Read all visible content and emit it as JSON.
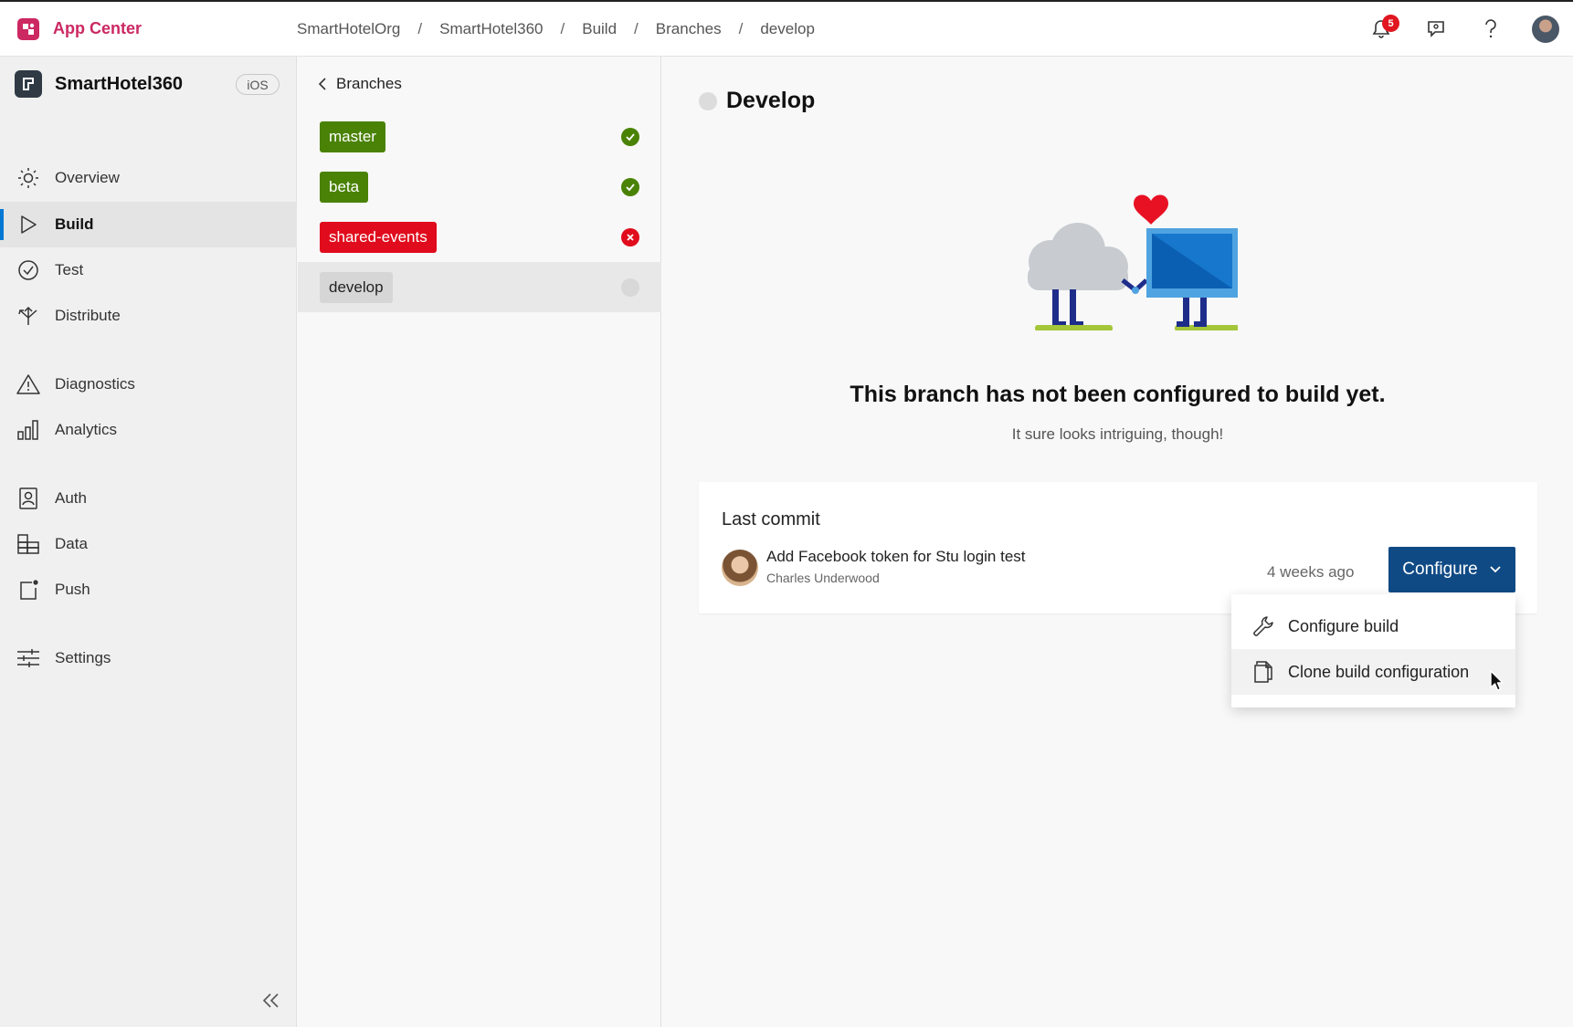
{
  "app": {
    "brand": "App Center"
  },
  "breadcrumb": [
    "SmartHotelOrg",
    "SmartHotel360",
    "Build",
    "Branches",
    "develop"
  ],
  "breadcrumb_sep": "/",
  "notifications": {
    "count": "5"
  },
  "sidebar": {
    "app_name": "SmartHotel360",
    "platform": "iOS",
    "items": [
      {
        "label": "Overview",
        "icon": "sun-icon"
      },
      {
        "label": "Build",
        "icon": "play-icon",
        "active": true
      },
      {
        "label": "Test",
        "icon": "check-circle-icon"
      },
      {
        "label": "Distribute",
        "icon": "distribute-icon"
      },
      {
        "label": "Diagnostics",
        "icon": "warning-icon"
      },
      {
        "label": "Analytics",
        "icon": "bar-chart-icon"
      },
      {
        "label": "Auth",
        "icon": "contact-card-icon"
      },
      {
        "label": "Data",
        "icon": "database-icon"
      },
      {
        "label": "Push",
        "icon": "push-notification-icon"
      },
      {
        "label": "Settings",
        "icon": "sliders-icon"
      }
    ]
  },
  "branches": {
    "back_label": "Branches",
    "list": [
      {
        "name": "master",
        "status": "success"
      },
      {
        "name": "beta",
        "status": "success"
      },
      {
        "name": "shared-events",
        "status": "failed"
      },
      {
        "name": "develop",
        "status": "not-configured",
        "selected": true
      }
    ]
  },
  "main": {
    "title": "Develop",
    "empty_title": "This branch has not been configured to build yet.",
    "empty_subtitle": "It sure looks intriguing, though!",
    "last_commit": {
      "heading": "Last commit",
      "message": "Add Facebook token for Stu login test",
      "author": "Charles Underwood",
      "time": "4 weeks ago"
    },
    "configure_label": "Configure",
    "dropdown": [
      {
        "label": "Configure build",
        "icon": "wrench-icon"
      },
      {
        "label": "Clone build configuration",
        "icon": "copy-icon"
      }
    ]
  },
  "colors": {
    "brand": "#cc2862",
    "accent": "#0078d4",
    "primary_button": "#0f4a85",
    "success": "#498205",
    "error": "#e00b1c"
  }
}
